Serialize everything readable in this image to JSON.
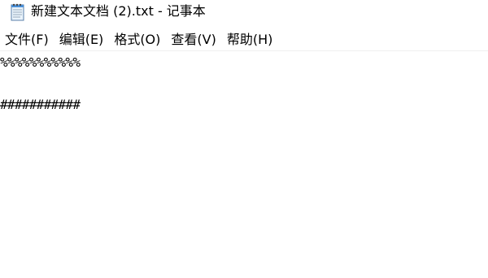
{
  "window": {
    "title": "新建文本文档 (2).txt - 记事本",
    "icon": "notepad-icon"
  },
  "menu": {
    "items": [
      {
        "label": "文件(F)"
      },
      {
        "label": "编辑(E)"
      },
      {
        "label": "格式(O)"
      },
      {
        "label": "查看(V)"
      },
      {
        "label": "帮助(H)"
      }
    ]
  },
  "editor": {
    "lines": [
      "%%%%%%%%%%%",
      "",
      "###########"
    ]
  }
}
